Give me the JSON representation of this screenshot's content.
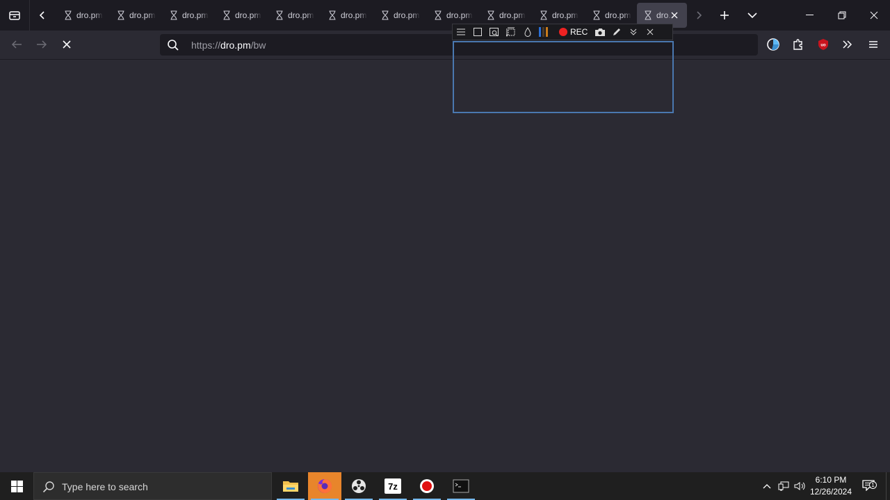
{
  "tabs": {
    "items": [
      {
        "label": "dro.pm"
      },
      {
        "label": "dro.pm"
      },
      {
        "label": "dro.pm"
      },
      {
        "label": "dro.pm"
      },
      {
        "label": "dro.pm"
      },
      {
        "label": "dro.pm"
      },
      {
        "label": "dro.pm"
      },
      {
        "label": "dro.pm"
      },
      {
        "label": "dro.pm"
      },
      {
        "label": "dro.pm"
      },
      {
        "label": "dro.pm"
      },
      {
        "label": "dro.pm"
      }
    ],
    "active_index": 11,
    "tab_icon": "hourglass-icon"
  },
  "navbar": {
    "url_scheme": "https://",
    "url_host": "dro.pm",
    "url_path": "/bw",
    "loading": true
  },
  "screenshot_tool": {
    "rec_label": "REC"
  },
  "taskbar": {
    "search_placeholder": "Type here to search",
    "apps": [
      "file-explorer",
      "firefox",
      "davinci-resolve",
      "7-zip",
      "obs-studio",
      "terminal"
    ],
    "app_7z_label": "7z",
    "time": "6:10 PM",
    "date": "12/26/2024",
    "notifications_count": "1"
  },
  "colors": {
    "page_bg": "#2b2a33",
    "tabstrip_bg": "#1c1b22",
    "accent_rec": "#ee2222",
    "selection_border": "#4a78b0"
  }
}
